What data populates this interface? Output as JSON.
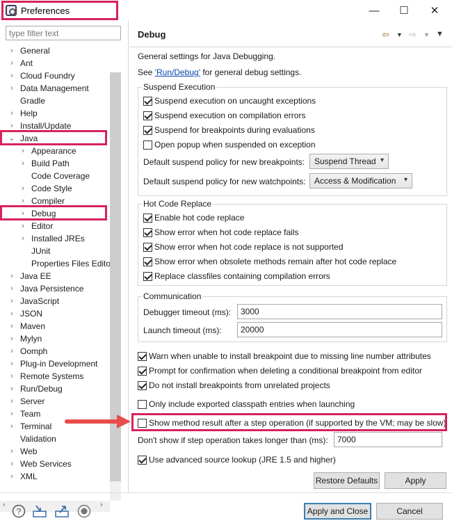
{
  "window": {
    "title": "Preferences",
    "minimize": "—",
    "maximize": "☐",
    "close": "✕"
  },
  "filter": {
    "placeholder": "type filter text"
  },
  "tree": [
    {
      "label": "General",
      "level": 0,
      "expander": ">"
    },
    {
      "label": "Ant",
      "level": 0,
      "expander": ">"
    },
    {
      "label": "Cloud Foundry",
      "level": 0,
      "expander": ">"
    },
    {
      "label": "Data Management",
      "level": 0,
      "expander": ">"
    },
    {
      "label": "Gradle",
      "level": 0,
      "expander": ""
    },
    {
      "label": "Help",
      "level": 0,
      "expander": ">"
    },
    {
      "label": "Install/Update",
      "level": 0,
      "expander": ">"
    },
    {
      "label": "Java",
      "level": 0,
      "expander": "v"
    },
    {
      "label": "Appearance",
      "level": 1,
      "expander": ">"
    },
    {
      "label": "Build Path",
      "level": 1,
      "expander": ">"
    },
    {
      "label": "Code Coverage",
      "level": 1,
      "expander": ""
    },
    {
      "label": "Code Style",
      "level": 1,
      "expander": ">"
    },
    {
      "label": "Compiler",
      "level": 1,
      "expander": ">"
    },
    {
      "label": "Debug",
      "level": 1,
      "expander": ">"
    },
    {
      "label": "Editor",
      "level": 1,
      "expander": ">"
    },
    {
      "label": "Installed JREs",
      "level": 1,
      "expander": ">"
    },
    {
      "label": "JUnit",
      "level": 1,
      "expander": ""
    },
    {
      "label": "Properties Files Editor",
      "level": 1,
      "expander": ""
    },
    {
      "label": "Java EE",
      "level": 0,
      "expander": ">"
    },
    {
      "label": "Java Persistence",
      "level": 0,
      "expander": ">"
    },
    {
      "label": "JavaScript",
      "level": 0,
      "expander": ">"
    },
    {
      "label": "JSON",
      "level": 0,
      "expander": ">"
    },
    {
      "label": "Maven",
      "level": 0,
      "expander": ">"
    },
    {
      "label": "Mylyn",
      "level": 0,
      "expander": ">"
    },
    {
      "label": "Oomph",
      "level": 0,
      "expander": ">"
    },
    {
      "label": "Plug-in Development",
      "level": 0,
      "expander": ">"
    },
    {
      "label": "Remote Systems",
      "level": 0,
      "expander": ">"
    },
    {
      "label": "Run/Debug",
      "level": 0,
      "expander": ">"
    },
    {
      "label": "Server",
      "level": 0,
      "expander": ">"
    },
    {
      "label": "Team",
      "level": 0,
      "expander": ">"
    },
    {
      "label": "Terminal",
      "level": 0,
      "expander": ">"
    },
    {
      "label": "Validation",
      "level": 0,
      "expander": ""
    },
    {
      "label": "Web",
      "level": 0,
      "expander": ">"
    },
    {
      "label": "Web Services",
      "level": 0,
      "expander": ">"
    },
    {
      "label": "XML",
      "level": 0,
      "expander": ">"
    }
  ],
  "page": {
    "title": "Debug",
    "description": "General settings for Java Debugging.",
    "see_prefix": "See ",
    "see_link": "'Run/Debug'",
    "see_suffix": " for general debug settings."
  },
  "suspend": {
    "title": "Suspend Execution",
    "options": [
      {
        "label": "Suspend execution on uncaught exceptions",
        "checked": true
      },
      {
        "label": "Suspend execution on compilation errors",
        "checked": true
      },
      {
        "label": "Suspend for breakpoints during evaluations",
        "checked": true
      },
      {
        "label": "Open popup when suspended on exception",
        "checked": false
      }
    ],
    "bp_policy_label": "Default suspend policy for new breakpoints:",
    "bp_policy_value": "Suspend Thread",
    "wp_policy_label": "Default suspend policy for new watchpoints:",
    "wp_policy_value": "Access & Modification"
  },
  "hcr": {
    "title": "Hot Code Replace",
    "options": [
      {
        "label": "Enable hot code replace",
        "checked": true
      },
      {
        "label": "Show error when hot code replace fails",
        "checked": true
      },
      {
        "label": "Show error when hot code replace is not supported",
        "checked": true
      },
      {
        "label": "Show error when obsolete methods remain after hot code replace",
        "checked": true
      },
      {
        "label": "Replace classfiles containing compilation errors",
        "checked": true
      }
    ]
  },
  "comm": {
    "title": "Communication",
    "timeout_label": "Debugger timeout (ms):",
    "timeout_value": "3000",
    "launch_label": "Launch timeout (ms):",
    "launch_value": "20000"
  },
  "misc": [
    {
      "label": "Warn when unable to install breakpoint due to missing line number attributes",
      "checked": true
    },
    {
      "label": "Prompt for confirmation when deleting a conditional breakpoint from editor",
      "checked": true
    },
    {
      "label": "Do not install breakpoints from unrelated projects",
      "checked": true
    },
    {
      "label": "Only include exported classpath entries when launching",
      "checked": false
    },
    {
      "label": "Show method result after a step operation (if supported by the VM; may be slow)",
      "checked": false
    }
  ],
  "step": {
    "label": "Don't show if step operation takes longer than (ms):",
    "value": "7000"
  },
  "source_lookup": {
    "label": "Use advanced source lookup (JRE 1.5 and higher)",
    "checked": true
  },
  "buttons": {
    "restore": "Restore Defaults",
    "apply": "Apply",
    "apply_close": "Apply and Close",
    "cancel": "Cancel"
  },
  "footer_icons": [
    "help-icon",
    "import-icon",
    "export-icon",
    "record-icon"
  ],
  "colors": {
    "highlight": "#d6235a",
    "link": "#0645ad",
    "arrow": "#e84c4c"
  }
}
